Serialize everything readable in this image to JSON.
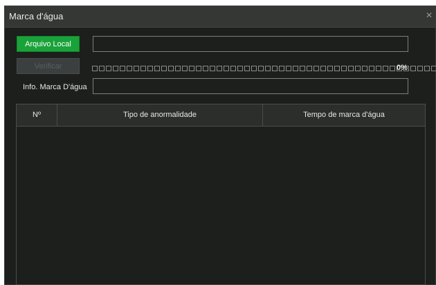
{
  "dialog": {
    "title": "Marca d'água",
    "close_glyph": "×"
  },
  "controls": {
    "local_file_label": "Arquivo Local",
    "verify_label": "Verificar",
    "file_path_value": "",
    "progress_percent_text": "0%",
    "progress_fraction": 0,
    "info_label": "Info. Marca D'água",
    "info_value": ""
  },
  "table": {
    "columns": [
      "Nº",
      "Tipo de anormalidade",
      "Tempo de marca d'água"
    ],
    "rows": []
  },
  "colors": {
    "accent_green": "#1aa23a",
    "background": "#1c1f1b",
    "titlebar": "#353734"
  }
}
